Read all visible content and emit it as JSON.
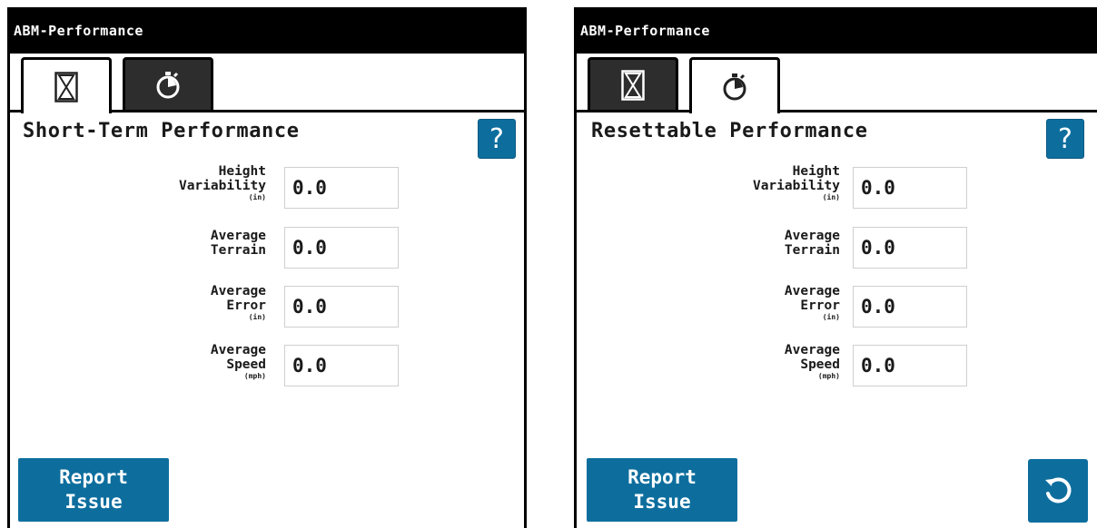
{
  "colors": {
    "accent": "#0d6e9e",
    "titlebar": "#000000",
    "tab_inactive": "#2d2d2d"
  },
  "panels": [
    {
      "title": "ABM-Performance",
      "tabs": [
        {
          "icon": "hourglass-icon",
          "active": true
        },
        {
          "icon": "stopwatch-icon",
          "active": false
        }
      ],
      "heading": "Short-Term Performance",
      "help_label": "?",
      "fields": [
        {
          "label": "Height\nVariability",
          "unit": "(in)",
          "value": "0.0"
        },
        {
          "label": "Average\nTerrain",
          "unit": "",
          "value": "0.0"
        },
        {
          "label": "Average\nError",
          "unit": "(in)",
          "value": "0.0"
        },
        {
          "label": "Average\nSpeed",
          "unit": "(mph)",
          "value": "0.0"
        }
      ],
      "report_button": "Report\nIssue"
    },
    {
      "title": "ABM-Performance",
      "tabs": [
        {
          "icon": "hourglass-icon",
          "active": false
        },
        {
          "icon": "stopwatch-icon",
          "active": true
        }
      ],
      "heading": "Resettable Performance",
      "help_label": "?",
      "fields": [
        {
          "label": "Height\nVariability",
          "unit": "(in)",
          "value": "0.0"
        },
        {
          "label": "Average\nTerrain",
          "unit": "",
          "value": "0.0"
        },
        {
          "label": "Average\nError",
          "unit": "(in)",
          "value": "0.0"
        },
        {
          "label": "Average\nSpeed",
          "unit": "(mph)",
          "value": "0.0"
        }
      ],
      "report_button": "Report\nIssue",
      "reset_icon": "reset-icon"
    }
  ]
}
